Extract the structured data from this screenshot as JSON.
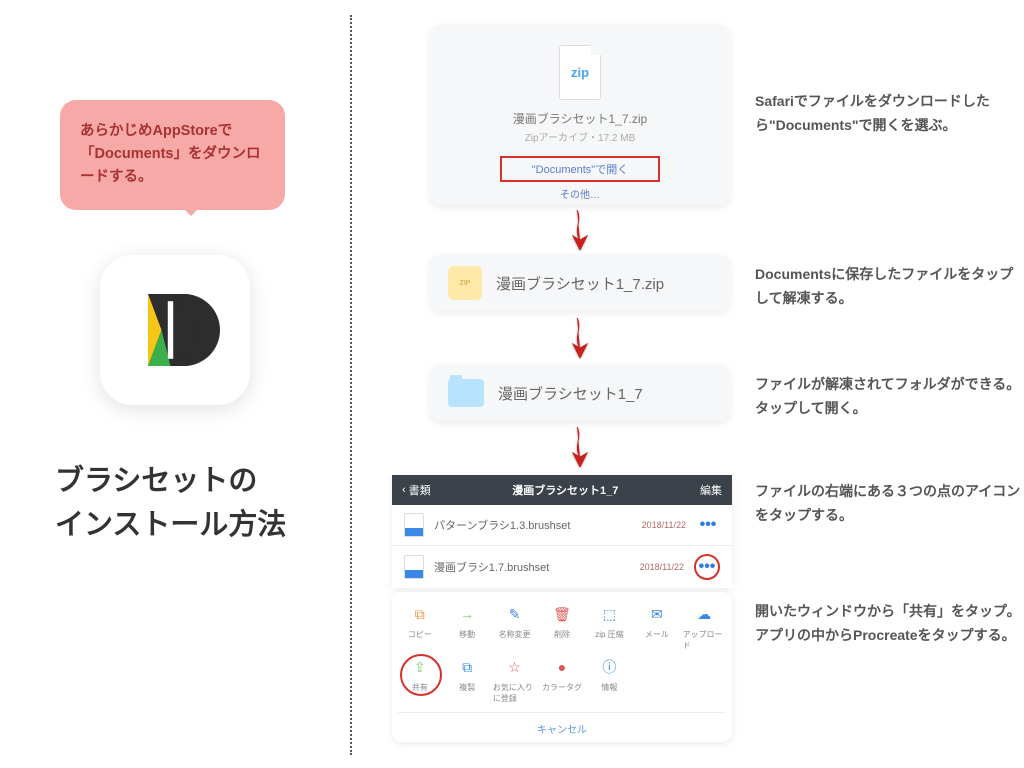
{
  "speechBubble": "あらかじめAppStoreで「Documents」をダウンロードする。",
  "title": "ブラシセットの\nインストール方法",
  "step1": {
    "zipLabel": "zip",
    "fileName": "漫画ブラシセット1_7.zip",
    "fileSize": "Zipアーカイブ・17.2 MB",
    "openIn": "\"Documents\"で開く",
    "other": "その他…"
  },
  "step2": {
    "label": "漫画ブラシセット1_7.zip"
  },
  "step3": {
    "label": "漫画ブラシセット1_7"
  },
  "step4": {
    "back": "書類",
    "title": "漫画ブラシセット1_7",
    "edit": "編集",
    "files": [
      {
        "name": "パターンブラシ1.3.brushset",
        "date": "2018/11/22"
      },
      {
        "name": "漫画ブラシ1.7.brushset",
        "date": "2018/11/22"
      }
    ],
    "more": "•••"
  },
  "step5": {
    "actions": [
      {
        "label": "コピー",
        "icon": "⧉",
        "color": "#ff8a3c"
      },
      {
        "label": "移動",
        "icon": "→",
        "color": "#7fc96f"
      },
      {
        "label": "名称変更",
        "icon": "✎",
        "color": "#3a88e8"
      },
      {
        "label": "削除",
        "icon": "🗑",
        "color": "#e05858"
      },
      {
        "label": "zip 圧縮",
        "icon": "⬚",
        "color": "#3a88e8"
      },
      {
        "label": "メール",
        "icon": "✉",
        "color": "#3a88e8"
      },
      {
        "label": "アップロード",
        "icon": "☁",
        "color": "#3a88e8"
      },
      {
        "label": "共有",
        "icon": "⇪",
        "color": "#7fc96f"
      },
      {
        "label": "複製",
        "icon": "⧉",
        "color": "#3a88e8"
      },
      {
        "label": "お気に入りに登録",
        "icon": "☆",
        "color": "#e05858"
      },
      {
        "label": "カラータグ",
        "icon": "●",
        "color": "#e05858"
      },
      {
        "label": "情報",
        "icon": "ⓘ",
        "color": "#3a88e8"
      }
    ],
    "cancel": "キャンセル"
  },
  "steps": {
    "s1": "Safariでファイルをダウンロードしたら\"Documents\"で開くを選ぶ。",
    "s2": "Documentsに保存したファイルをタップして解凍する。",
    "s3": "ファイルが解凍されてフォルダができる。タップして開く。",
    "s4": "ファイルの右端にある３つの点のアイコンをタップする。",
    "s5": "開いたウィンドウから「共有」をタップ。アプリの中からProcreateをタップする。"
  }
}
